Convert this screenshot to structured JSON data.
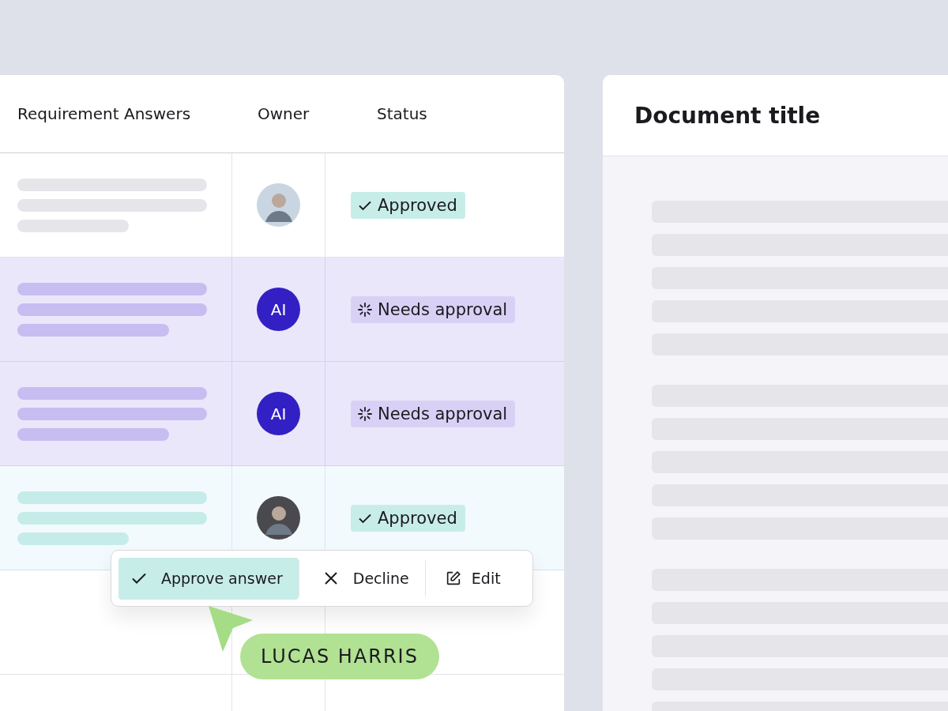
{
  "table": {
    "columns": [
      "Requirement Answers",
      "Owner",
      "Status"
    ],
    "rows": [
      {
        "kind": "approved",
        "selected": false,
        "owner": {
          "kind": "photo"
        },
        "status": {
          "kind": "approved",
          "label": "Approved"
        }
      },
      {
        "kind": "pending",
        "selected": false,
        "owner": {
          "kind": "initials",
          "text": "AI"
        },
        "status": {
          "kind": "pending",
          "label": "Needs approval"
        }
      },
      {
        "kind": "pending",
        "selected": false,
        "owner": {
          "kind": "initials",
          "text": "AI"
        },
        "status": {
          "kind": "pending",
          "label": "Needs approval"
        }
      },
      {
        "kind": "approved",
        "selected": true,
        "owner": {
          "kind": "photo"
        },
        "status": {
          "kind": "approved",
          "label": "Approved"
        }
      },
      {
        "kind": "empty",
        "selected": false
      },
      {
        "kind": "empty",
        "selected": false
      }
    ]
  },
  "action_menu": {
    "buttons": [
      {
        "kind": "approve",
        "label": "Approve answer"
      },
      {
        "kind": "decline",
        "label": "Decline"
      },
      {
        "kind": "edit",
        "label": "Edit"
      }
    ]
  },
  "cursor": {
    "name": "LUCAS HARRIS"
  },
  "document": {
    "title": "Document title"
  }
}
